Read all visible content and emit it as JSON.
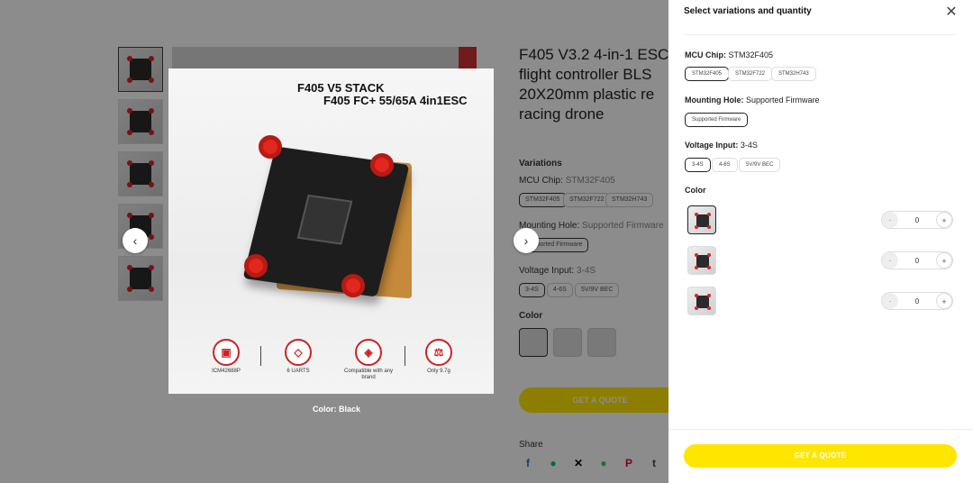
{
  "product": {
    "title_lines": [
      "F405 V3.2 4-in-1 ESC",
      "flight controller BLS",
      "20X20mm plastic re",
      "racing drone"
    ],
    "variations_label": "Variations",
    "mcu_label": "MCU Chip:",
    "mcu_value": "STM32F405",
    "mcu_options": [
      "STM32F405",
      "STM32F722",
      "STM32H743"
    ],
    "mounting_label": "Mounting Hole:",
    "mounting_value": "Supported Firmware",
    "mounting_options": [
      "Supported Firmware"
    ],
    "voltage_label": "Voltage Input:",
    "voltage_value": "3-4S",
    "voltage_options": [
      "3-4S",
      "4-6S",
      "5V/9V BEC"
    ],
    "color_label": "Color",
    "quote_label": "GET A QUOTE",
    "share_label": "Share",
    "share_icons": [
      "facebook-icon",
      "line-icon",
      "x-icon",
      "whatsapp-icon",
      "pinterest-icon",
      "tumblr-icon"
    ]
  },
  "lightbox": {
    "title_line1": "F405 V5 STACK",
    "title_line2": "F405 FC+ 55/65A 4in1ESC",
    "features": [
      {
        "label": "ICM42688P",
        "icon": "imu-icon"
      },
      {
        "label": "6 UARTS",
        "icon": "cube-icon"
      },
      {
        "label": "Compatible with any brand",
        "icon": "layers-icon"
      },
      {
        "label": "Only 9.7g",
        "icon": "weight-icon"
      }
    ],
    "caption": "Color: Black",
    "prev_glyph": "‹",
    "next_glyph": "›"
  },
  "panel": {
    "heading": "Select variations and quantity",
    "close_glyph": "✕",
    "mcu_label": "MCU Chip:",
    "mcu_value": "STM32F405",
    "mcu_options": [
      "STM32F405",
      "STM32F722",
      "STM32H743"
    ],
    "mounting_label": "Mounting Hole:",
    "mounting_value": "Supported Firmware",
    "mounting_options": [
      "Supported Firmware"
    ],
    "voltage_label": "Voltage Input:",
    "voltage_value": "3-4S",
    "voltage_options": [
      "3-4S",
      "4-6S",
      "5V/9V BEC"
    ],
    "color_label": "Color",
    "color_rows": [
      {
        "qty": "0",
        "minus": "-",
        "plus": "+"
      },
      {
        "qty": "0",
        "minus": "-",
        "plus": "+"
      },
      {
        "qty": "0",
        "minus": "-",
        "plus": "+"
      }
    ],
    "quote_label": "GET A QUOTE"
  },
  "colors": {
    "accent_yellow": "#ffe600",
    "post_red": "#e2271e"
  }
}
